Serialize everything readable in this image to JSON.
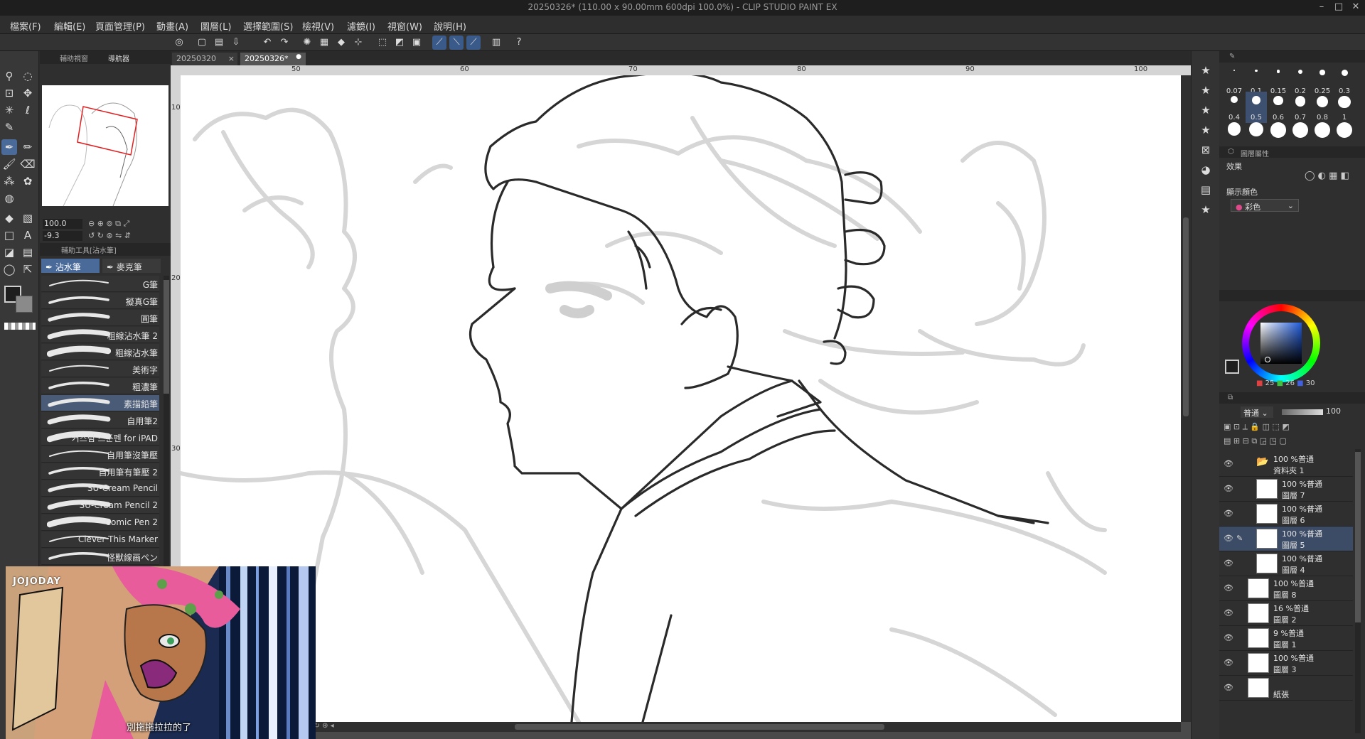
{
  "window": {
    "title": "20250326* (110.00 x 90.00mm 600dpi 100.0%)  - CLIP STUDIO PAINT EX"
  },
  "menu": [
    "檔案(F)",
    "編輯(E)",
    "頁面管理(P)",
    "動畫(A)",
    "圖層(L)",
    "選擇範圍(S)",
    "檢視(V)",
    "濾鏡(I)",
    "視窗(W)",
    "說明(H)"
  ],
  "navigator": {
    "tabs": [
      "輔助視窗",
      "導航器"
    ],
    "zoom": "100.0",
    "angle": "-9.3"
  },
  "subtool": {
    "header": "輔助工具[沾水筆]",
    "groups": [
      "沾水筆",
      "麥克筆"
    ],
    "brushes": [
      "G筆",
      "擬真G筆",
      "圓筆",
      "粗線沾水筆 2",
      "粗線沾水筆",
      "美術字",
      "粗濃筆",
      "素描鉛筆",
      "自用筆2",
      "커스텀 스푼펜 for iPAD",
      "自用筆沒筆壓",
      "自用筆有筆壓 2",
      "SU-Cream Pencil",
      "SU-Cream Pencil 2",
      "Comic Pen 2",
      "Clever This Marker",
      "怪獸線画ペン"
    ],
    "selected": "素描鉛筆"
  },
  "doc_tabs": [
    "20250320",
    "20250326*"
  ],
  "ruler": [
    "50",
    "60",
    "70",
    "80",
    "90",
    "100"
  ],
  "vruler": [
    "10",
    "20",
    "30"
  ],
  "brush_sizes": [
    "0.07",
    "0.1",
    "0.15",
    "0.2",
    "0.25",
    "0.3",
    "0.4",
    "0.5",
    "0.6",
    "0.7",
    "0.8",
    "1",
    "",
    "",
    "",
    "",
    "",
    ""
  ],
  "layer_property": {
    "header": "圖層屬性",
    "effect_label": "效果",
    "color_label": "顯示顏色",
    "color_value": "彩色"
  },
  "color": {
    "r": "25",
    "g": "26",
    "b": "30"
  },
  "layer_panel": {
    "blend": "普通",
    "opacity": "100"
  },
  "layers": [
    {
      "line1": "100 %普通",
      "line2": "資料夾 1"
    },
    {
      "line1": "100 %普通",
      "line2": "圖層 7"
    },
    {
      "line1": "100 %普通",
      "line2": "圖層 6"
    },
    {
      "line1": "100 %普通",
      "line2": "圖層 5"
    },
    {
      "line1": "100 %普通",
      "line2": "圖層 4"
    },
    {
      "line1": "100 %普通",
      "line2": "圖層 8"
    },
    {
      "line1": "16 %普通",
      "line2": "圖層 2"
    },
    {
      "line1": "9 %普通",
      "line2": "圖層 1"
    },
    {
      "line1": "100 %普通",
      "line2": "圖層 3"
    },
    {
      "line1": "",
      "line2": "紙張"
    }
  ],
  "video": {
    "logo": "JOJODAY",
    "caption": "別拖拖拉拉的了"
  },
  "colors": {
    "accent": "#4a6a9a",
    "selected_layer": "#3d4c66"
  }
}
